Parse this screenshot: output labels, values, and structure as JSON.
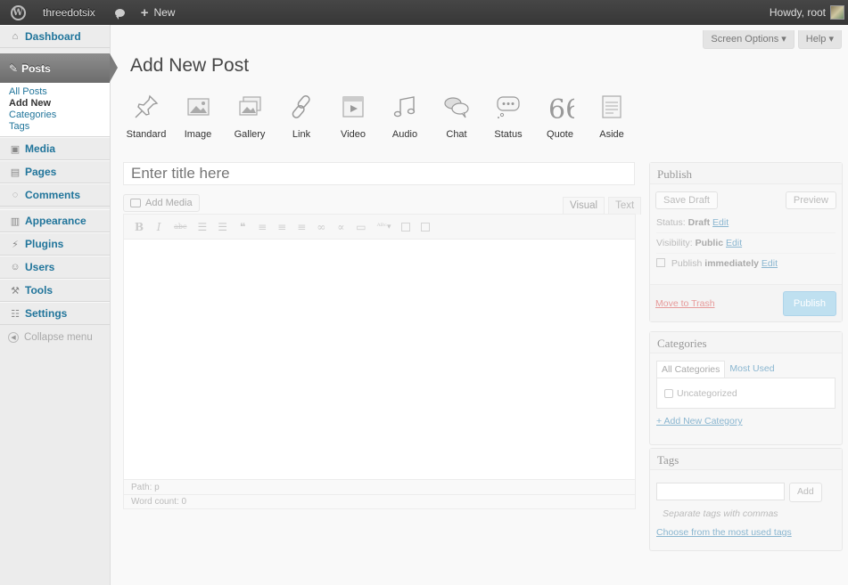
{
  "adminbar": {
    "site_name": "threedotsix",
    "new_label": "New",
    "howdy": "Howdy, root"
  },
  "sidebar": {
    "dashboard": "Dashboard",
    "posts": "Posts",
    "submenu": [
      "All Posts",
      "Add New",
      "Categories",
      "Tags"
    ],
    "media": "Media",
    "pages": "Pages",
    "comments": "Comments",
    "appearance": "Appearance",
    "plugins": "Plugins",
    "users": "Users",
    "tools": "Tools",
    "settings": "Settings",
    "collapse": "Collapse menu"
  },
  "screen_tabs": {
    "screen_options": "Screen Options ▾",
    "help": "Help ▾"
  },
  "page_title": "Add New Post",
  "formats": [
    {
      "label": "Standard",
      "icon": "pushpin-icon"
    },
    {
      "label": "Image",
      "icon": "image-icon"
    },
    {
      "label": "Gallery",
      "icon": "gallery-icon"
    },
    {
      "label": "Link",
      "icon": "link-icon"
    },
    {
      "label": "Video",
      "icon": "video-icon"
    },
    {
      "label": "Audio",
      "icon": "audio-icon"
    },
    {
      "label": "Chat",
      "icon": "chat-icon"
    },
    {
      "label": "Status",
      "icon": "status-icon"
    },
    {
      "label": "Quote",
      "icon": "quote-icon"
    },
    {
      "label": "Aside",
      "icon": "aside-icon"
    }
  ],
  "editor": {
    "title_placeholder": "Enter title here",
    "add_media": "Add Media",
    "tab_visual": "Visual",
    "tab_text": "Text",
    "path": "Path: p",
    "word_count": "Word count: 0"
  },
  "publish": {
    "title": "Publish",
    "save_draft": "Save Draft",
    "preview": "Preview",
    "status_label": "Status:",
    "status_value": "Draft",
    "visibility_label": "Visibility:",
    "visibility_value": "Public",
    "publish_label": "Publish",
    "publish_value": "immediately",
    "edit": "Edit",
    "trash": "Move to Trash",
    "publish_button": "Publish"
  },
  "categories": {
    "title": "Categories",
    "tab_all": "All Categories",
    "tab_most_used": "Most Used",
    "items": [
      "Uncategorized"
    ],
    "add_new": "+ Add New Category"
  },
  "tags": {
    "title": "Tags",
    "add_button": "Add",
    "hint": "Separate tags with commas",
    "choose": "Choose from the most used tags"
  }
}
